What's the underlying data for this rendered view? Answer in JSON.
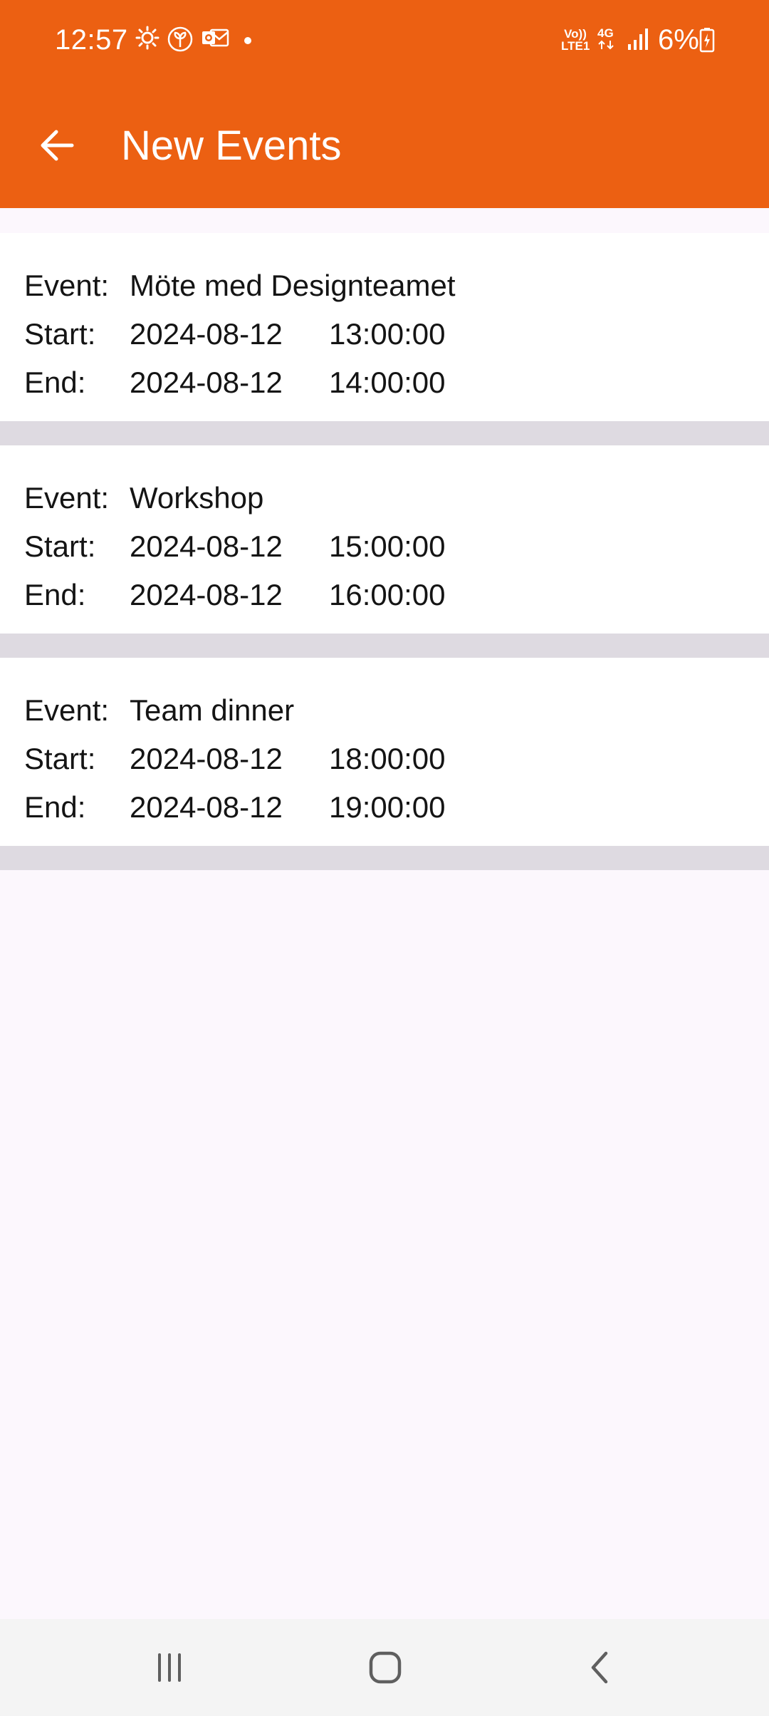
{
  "status_bar": {
    "time": "12:57",
    "network_lte": "LTE1",
    "network_volte": "Vo))",
    "network_type": "4G",
    "battery": "6%",
    "icons": [
      "brightness-icon",
      "leaf-icon",
      "outlook-icon",
      "dot-icon",
      "signal-icon",
      "battery-charging-icon"
    ]
  },
  "app_bar": {
    "title": "New Events",
    "back_icon": "arrow-left-icon"
  },
  "labels": {
    "event": "Event:",
    "start": "Start:",
    "end": "End:"
  },
  "events": [
    {
      "name": "Möte med Designteamet",
      "start_date": "2024-08-12",
      "start_time": "13:00:00",
      "end_date": "2024-08-12",
      "end_time": "14:00:00"
    },
    {
      "name": "Workshop",
      "start_date": "2024-08-12",
      "start_time": "15:00:00",
      "end_date": "2024-08-12",
      "end_time": "16:00:00"
    },
    {
      "name": "Team dinner",
      "start_date": "2024-08-12",
      "start_time": "18:00:00",
      "end_date": "2024-08-12",
      "end_time": "19:00:00"
    }
  ],
  "nav_bar": {
    "icons": [
      "recent-apps-icon",
      "home-icon",
      "back-icon"
    ]
  },
  "colors": {
    "primary": "#EC6012",
    "background": "#FCF7FD",
    "card": "#FFFFFF",
    "separator": "#DEDAE1",
    "text": "#141414"
  }
}
